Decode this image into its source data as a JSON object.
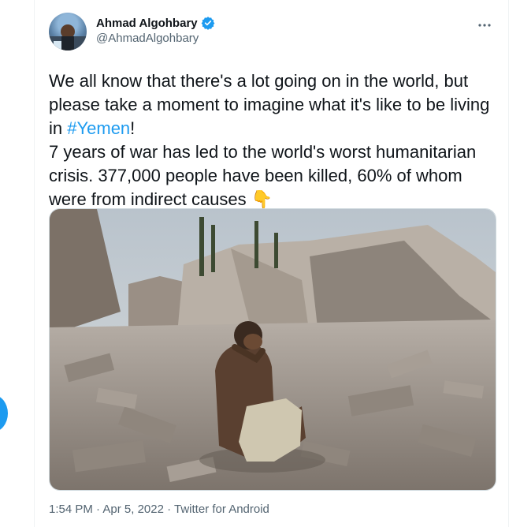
{
  "author": {
    "display_name": "Ahmad Algohbary",
    "handle": "@AhmadAlgohbary",
    "verified": true,
    "avatar_icon": "profile-avatar"
  },
  "tweet": {
    "line1": "We all know that there's a lot going on in the world, but please take a moment to imagine what it's like to be living in ",
    "hashtag": "#Yemen",
    "line1_end": "!",
    "line2": "7 years of war has led to the world's worst humanitarian crisis. 377,000 people have been killed, 60% of whom were from indirect causes ",
    "emoji": "👇"
  },
  "meta": {
    "time": "1:54 PM",
    "sep1": " · ",
    "date": "Apr 5, 2022",
    "sep2": " · ",
    "source": "Twitter for Android"
  },
  "colors": {
    "link": "#1d9bf0",
    "secondary_text": "#536471",
    "primary_text": "#0f1419"
  },
  "icons": {
    "more": "more-icon",
    "verified": "verified-badge-icon"
  }
}
